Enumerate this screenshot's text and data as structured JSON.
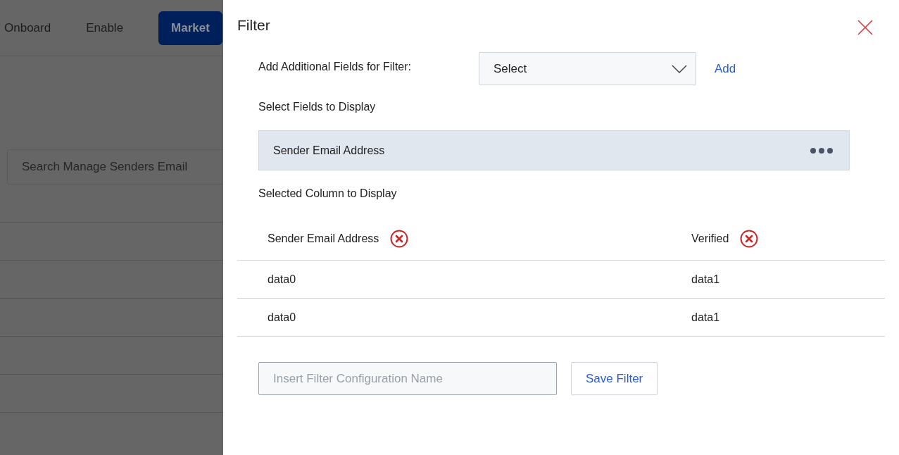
{
  "background": {
    "tabs": [
      {
        "label": "Onboard",
        "selected": false
      },
      {
        "label": "Enable",
        "selected": false
      },
      {
        "label": "Market",
        "selected": true
      }
    ],
    "search": {
      "placeholder": "Search Manage Senders Email"
    }
  },
  "drawer": {
    "title": "Filter",
    "additional_fields": {
      "label": "Add Additional Fields for Filter:",
      "select": "Select",
      "add": "Add"
    },
    "fields_heading": "Select Fields to Display",
    "fields": [
      "Sender Email Address"
    ],
    "columns_heading": "Selected Column to Display",
    "table": {
      "columns": [
        "Sender Email Address",
        "Verified"
      ],
      "rows": [
        [
          "data0",
          "data1"
        ],
        [
          "data0",
          "data1"
        ]
      ]
    },
    "name_field": {
      "placeholder": "Insert Filter Configuration Name"
    },
    "save": "Save Filter"
  }
}
